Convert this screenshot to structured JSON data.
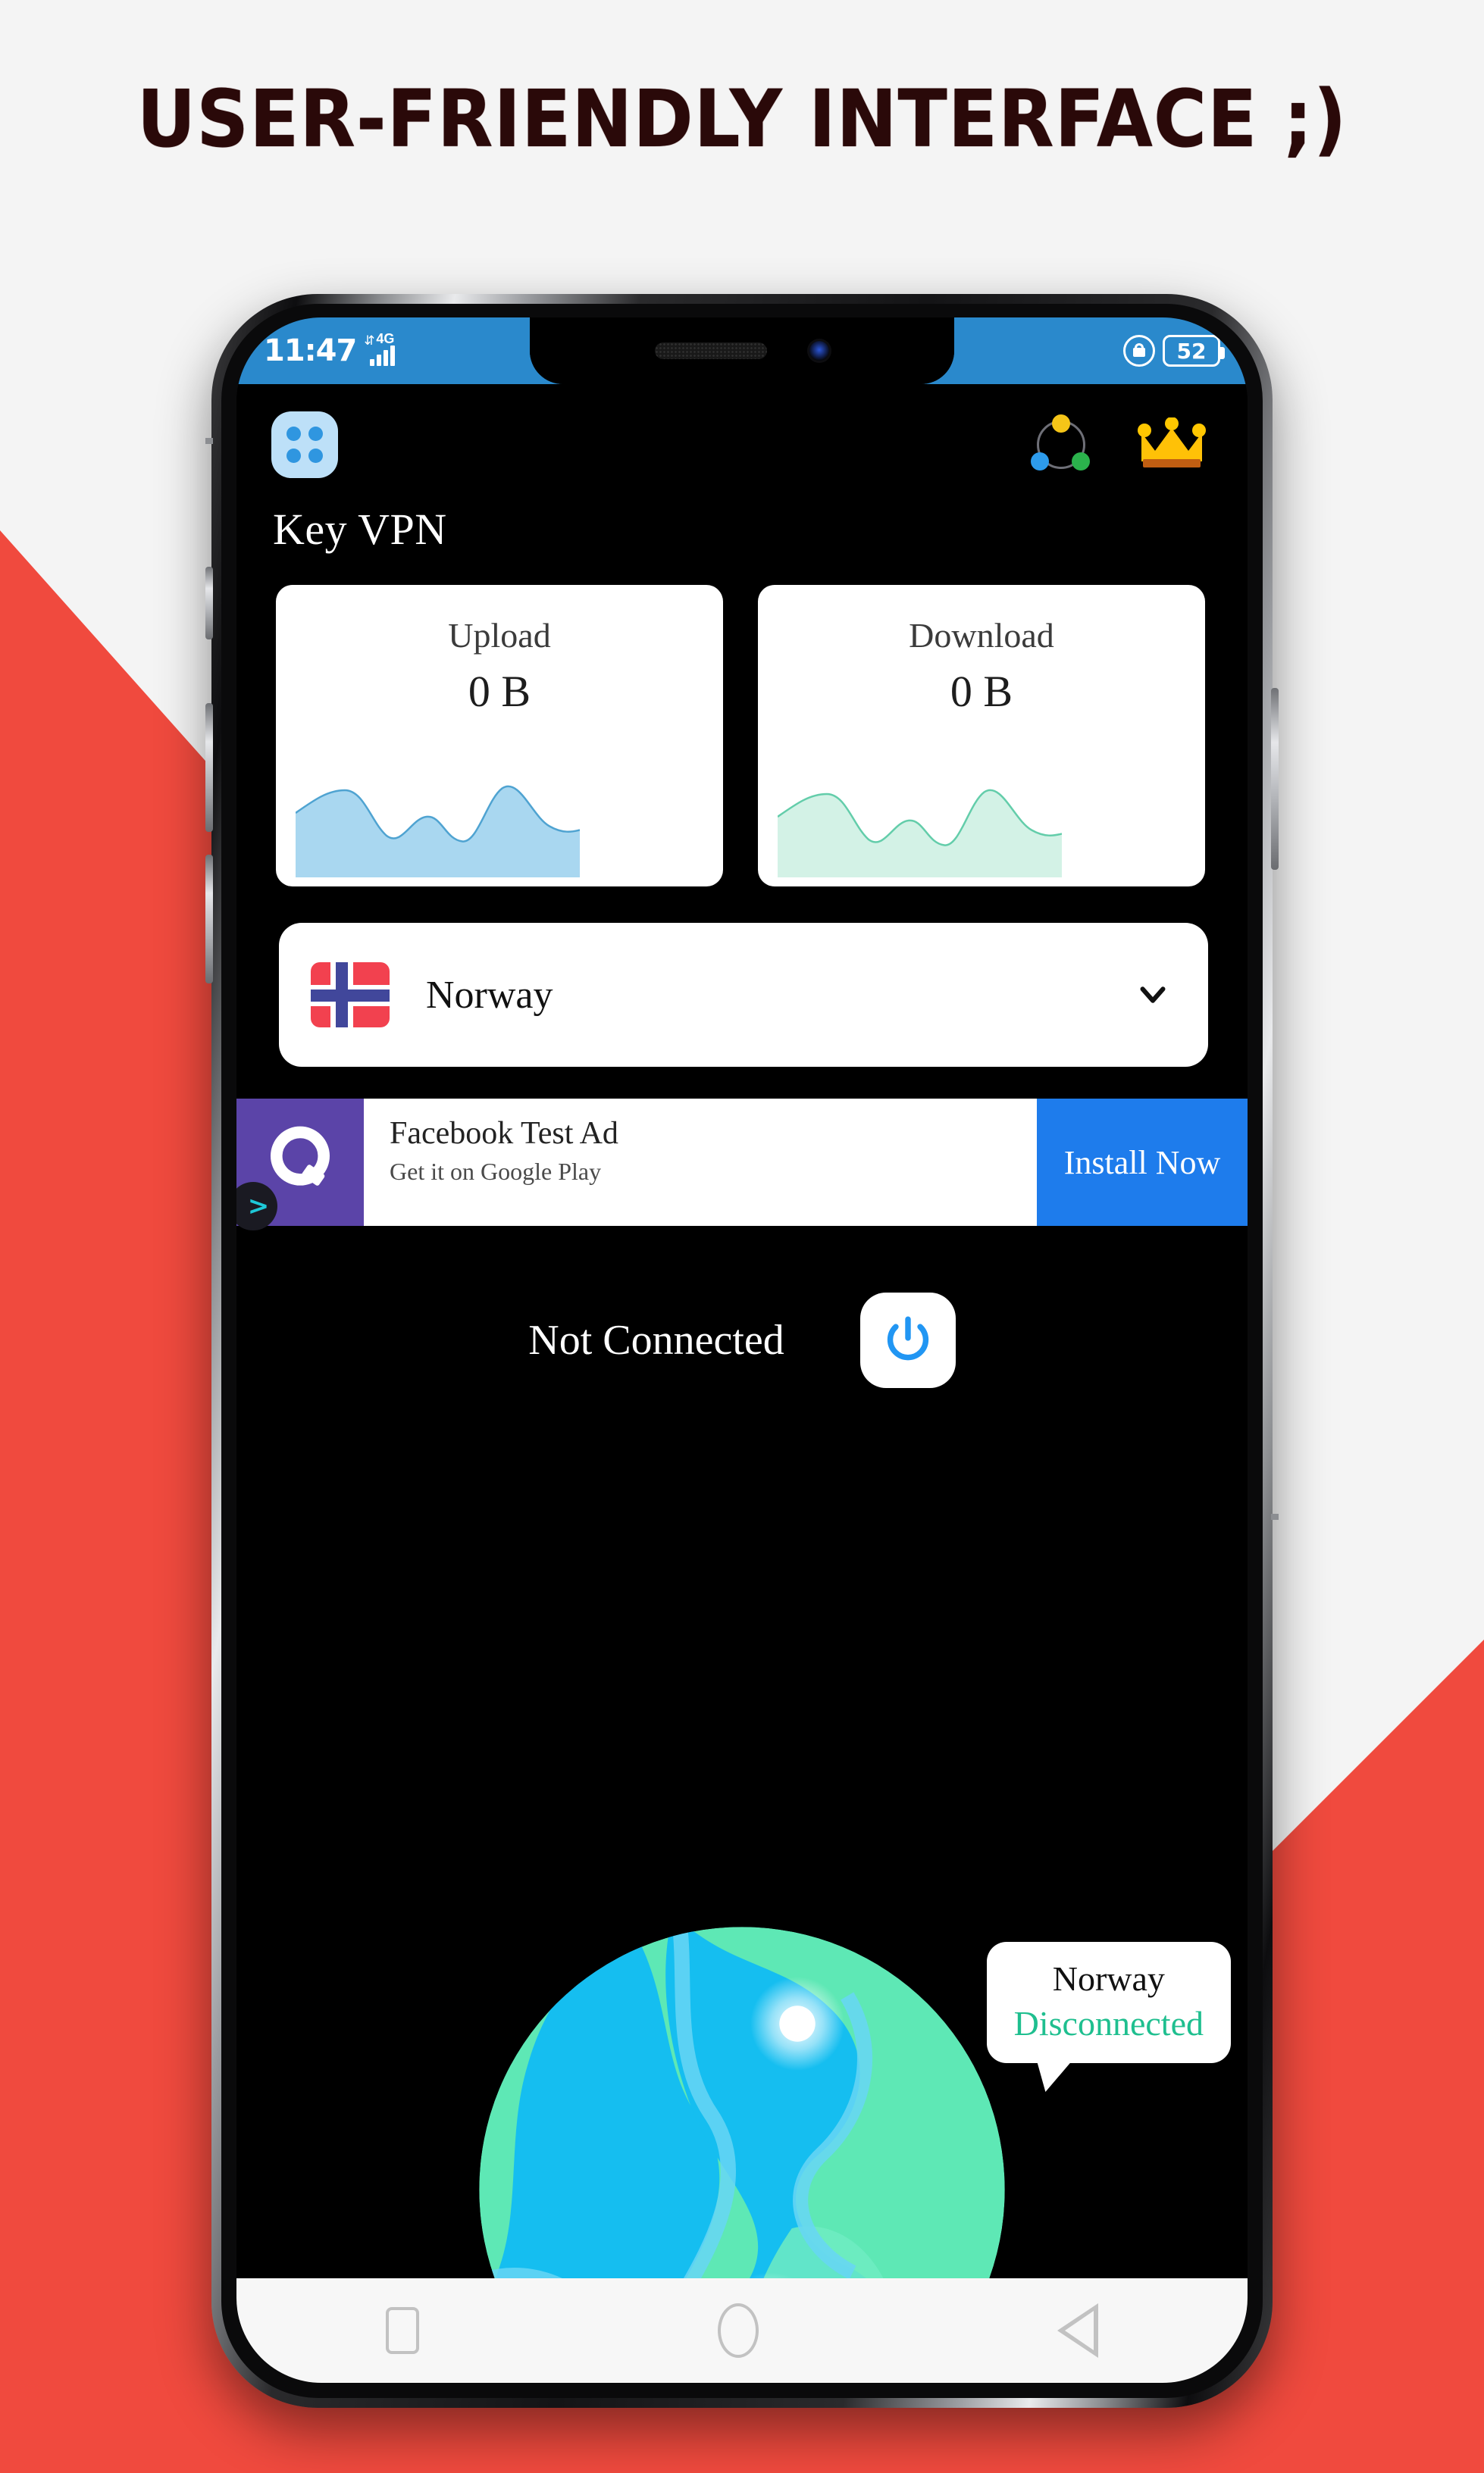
{
  "headline": "USER-FRIENDLY INTERFACE ;)",
  "colors": {
    "accent_red": "#F04A3E",
    "statusbar_blue": "#2A89CC",
    "cta_blue": "#1E7CEC",
    "upload_wave": "#A9D7F0",
    "download_wave": "#CBEFE2",
    "disconnected_green": "#1FBF8F",
    "ad_icon_purple": "#5B44A8",
    "crown_gold": "#FFC700"
  },
  "status_bar": {
    "time": "11:47",
    "network_label": "4G",
    "signal_icon": "signal-bars-icon",
    "rotation_lock_icon": "rotation-lock-icon",
    "battery_level": "52"
  },
  "app": {
    "menu_icon": "grid-menu-icon",
    "servers_icon": "servers-connection-icon",
    "premium_icon": "crown-icon",
    "title": "Key VPN",
    "speed_cards": [
      {
        "label": "Upload",
        "value": "0 B",
        "wave": "upload-wave-chart"
      },
      {
        "label": "Download",
        "value": "0 B",
        "wave": "download-wave-chart"
      }
    ],
    "country_selector": {
      "flag_icon": "norway-flag-icon",
      "country": "Norway",
      "chevron_icon": "chevron-down-icon"
    },
    "ad_banner": {
      "icon_name": "facebook-ad-app-icon",
      "adchoices_label": ">",
      "title": "Facebook Test Ad",
      "subtitle": "Get it on Google Play",
      "cta_label": "Install Now"
    },
    "connection": {
      "status_text": "Not Connected",
      "power_icon": "power-button-icon"
    },
    "globe": {
      "icon_name": "world-globe-icon",
      "tooltip_country": "Norway",
      "tooltip_status": "Disconnected"
    }
  },
  "nav_bar": {
    "recents_icon": "square-recents-icon",
    "home_icon": "circle-home-icon",
    "back_icon": "triangle-back-icon"
  },
  "chart_data": [
    {
      "type": "area",
      "title": "Upload",
      "x": [
        0,
        1,
        2,
        3,
        4,
        5,
        6,
        7,
        8,
        9,
        10
      ],
      "values": [
        62,
        78,
        80,
        58,
        34,
        52,
        58,
        36,
        56,
        84,
        58
      ],
      "ylabel": "",
      "xlabel": "",
      "ylim": [
        0,
        100
      ],
      "grid": false,
      "legend": "none"
    },
    {
      "type": "area",
      "title": "Download",
      "x": [
        0,
        1,
        2,
        3,
        4,
        5,
        6,
        7,
        8,
        9,
        10
      ],
      "values": [
        58,
        74,
        78,
        54,
        30,
        48,
        54,
        32,
        52,
        80,
        52
      ],
      "ylabel": "",
      "xlabel": "",
      "ylim": [
        0,
        100
      ],
      "grid": false,
      "legend": "none"
    }
  ]
}
